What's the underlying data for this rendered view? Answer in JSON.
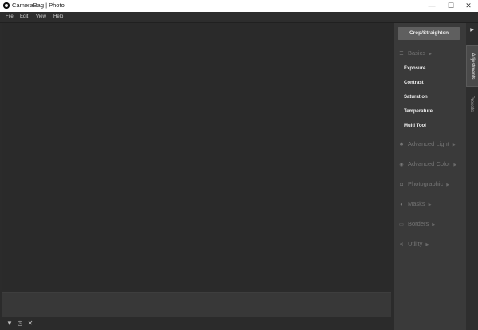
{
  "window": {
    "title": "CameraBag | Photo",
    "controls": {
      "minimize": "—",
      "maximize": "☐",
      "close": "✕"
    }
  },
  "menu": [
    "File",
    "Edit",
    "View",
    "Help"
  ],
  "panel": {
    "primary_button": "Crop/Straighten",
    "sections": [
      {
        "label": "Basics",
        "icon": "sliders-icon",
        "expanded": true,
        "items": [
          "Exposure",
          "Contrast",
          "Saturation",
          "Temperature",
          "Multi Tool"
        ]
      },
      {
        "label": "Advanced Light",
        "icon": "sun-icon"
      },
      {
        "label": "Advanced Color",
        "icon": "color-drop-icon"
      },
      {
        "label": "Photographic",
        "icon": "camera-icon"
      },
      {
        "label": "Masks",
        "icon": "mask-icon"
      },
      {
        "label": "Borders",
        "icon": "border-frame-icon"
      },
      {
        "label": "Utility",
        "icon": "share-nodes-icon"
      }
    ]
  },
  "tabs": {
    "adjustments": "Adjustments",
    "presets": "Presets"
  },
  "footer": {
    "icons": [
      "triangle-down-icon",
      "timer-icon",
      "close-icon"
    ]
  },
  "colors": {
    "background": "#2b2b2b",
    "panel": "#3a3a3a",
    "button": "#5f5f5f"
  }
}
